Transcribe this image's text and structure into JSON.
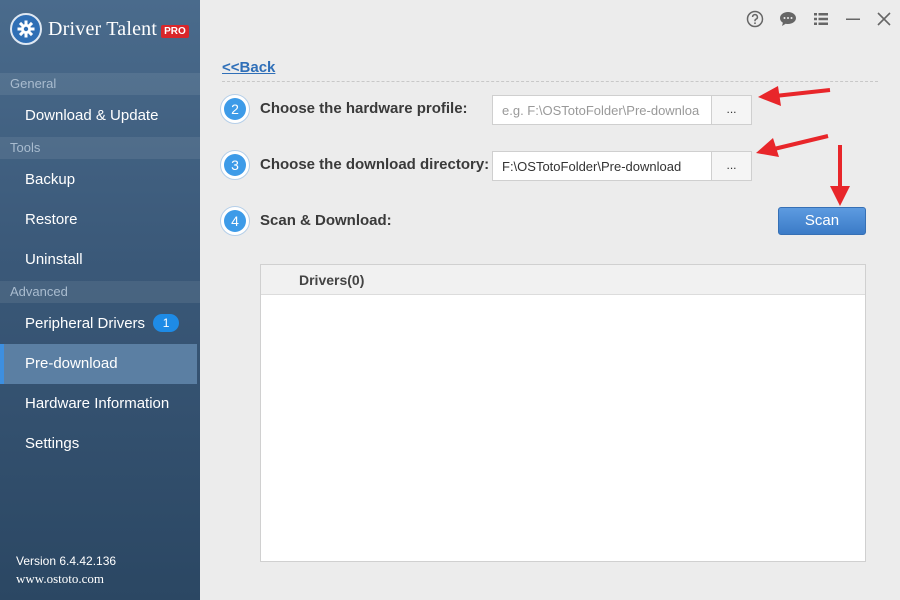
{
  "app": {
    "name": "Driver Talent",
    "edition_badge": "PRO",
    "icon": "gear-icon",
    "version_label": "Version 6.4.42.136",
    "website": "www.ostoto.com"
  },
  "title_bar": {
    "buttons": [
      "help-icon",
      "feedback-icon",
      "menu-icon",
      "minimize-icon",
      "close-icon"
    ]
  },
  "sidebar": {
    "sections": [
      {
        "label": "General"
      },
      {
        "label": "Tools"
      },
      {
        "label": "Advanced"
      }
    ],
    "items": [
      {
        "label": "Download & Update"
      },
      {
        "label": "Backup"
      },
      {
        "label": "Restore"
      },
      {
        "label": "Uninstall"
      },
      {
        "label": "Peripheral Drivers",
        "badge": "1"
      },
      {
        "label": "Pre-download",
        "active": true
      },
      {
        "label": "Hardware Information"
      },
      {
        "label": "Settings"
      }
    ]
  },
  "main": {
    "back_label": "<<Back",
    "steps": [
      {
        "number": "2",
        "label": "Choose the hardware profile:",
        "input_value": "",
        "input_placeholder": "e.g. F:\\OSTotoFolder\\Pre-downloa",
        "browse_label": "..."
      },
      {
        "number": "3",
        "label": "Choose the download directory:",
        "input_value": "F:\\OSTotoFolder\\Pre-download",
        "input_placeholder": "",
        "browse_label": "..."
      },
      {
        "number": "4",
        "label": "Scan & Download:",
        "button_label": "Scan"
      }
    ],
    "drivers_header": "Drivers(0)"
  },
  "colors": {
    "accent": "#3d8fe0",
    "annotation_arrow": "#e8262a"
  }
}
